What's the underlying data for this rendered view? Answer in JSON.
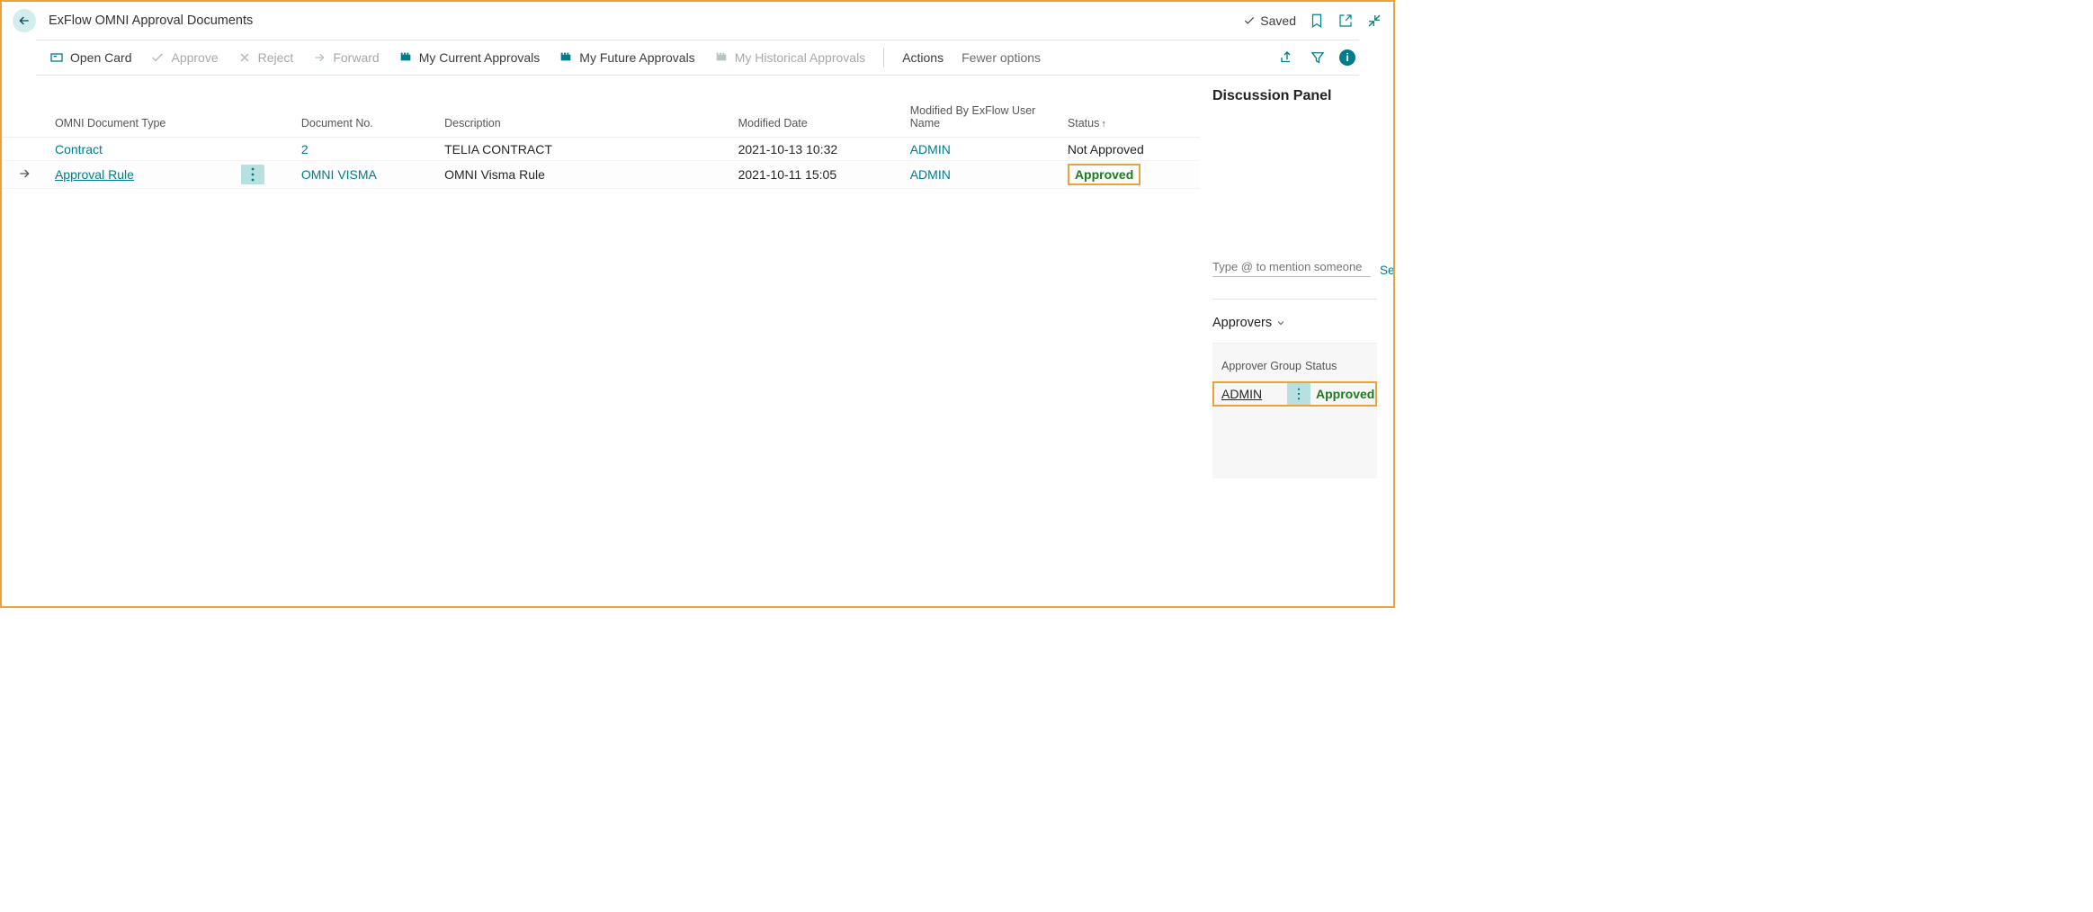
{
  "header": {
    "title": "ExFlow OMNI Approval Documents",
    "saved_label": "Saved"
  },
  "toolbar": {
    "open_card": "Open Card",
    "approve": "Approve",
    "reject": "Reject",
    "forward": "Forward",
    "my_current": "My Current Approvals",
    "my_future": "My Future Approvals",
    "my_historical": "My Historical Approvals",
    "actions": "Actions",
    "fewer_options": "Fewer options"
  },
  "columns": {
    "doc_type": "OMNI Document Type",
    "doc_no": "Document No.",
    "description": "Description",
    "modified_date": "Modified Date",
    "modified_by": "Modified By ExFlow User Name",
    "status": "Status"
  },
  "rows": [
    {
      "doc_type": "Contract",
      "doc_no": "2",
      "description": "TELIA CONTRACT",
      "modified_date": "2021-10-13 10:32",
      "modified_by": "ADMIN",
      "status": "Not Approved"
    },
    {
      "doc_type": "Approval Rule",
      "doc_no": "OMNI VISMA",
      "description": "OMNI Visma Rule",
      "modified_date": "2021-10-11 15:05",
      "modified_by": "ADMIN",
      "status": "Approved"
    }
  ],
  "panel": {
    "title": "Discussion Panel",
    "mention_placeholder": "Type @ to mention someone",
    "send": "Send",
    "approvers_title": "Approvers",
    "approver_cols": {
      "group": "Approver Group",
      "status": "Status"
    },
    "approver_row": {
      "group": "ADMIN",
      "status": "Approved"
    }
  }
}
